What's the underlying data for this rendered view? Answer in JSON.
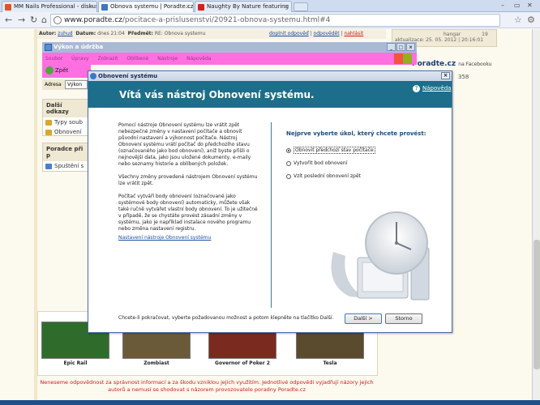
{
  "browser": {
    "tabs": [
      {
        "label": "MM Nails Professional - diskuse",
        "active": false,
        "color": "#e0522a"
      },
      {
        "label": "Obnova systemu | Poradte.cz",
        "active": true,
        "color": "#3a77c9"
      },
      {
        "label": "Naughty By Nature featuring",
        "active": false,
        "color": "#d32020"
      }
    ],
    "url_domain": "www.poradte.cz",
    "url_path": "/pocitace-a-prislusenstvi/20921-obnova-systemu.html#4"
  },
  "forum": {
    "author_label": "Autor:",
    "author": "zuhud",
    "date_label": "Datum:",
    "date": "dnes 21:04",
    "subject_label": "Předmět:",
    "subject": "RE: Obnova systemu",
    "links": [
      "doplnit odpověď",
      "odpovědět",
      "nahlásit"
    ],
    "right_user": "hangar",
    "right_count": "19",
    "right_updated": "aktualizace: 25. 05. 2012 | 20:16:01",
    "fb_brand": "Poradte.cz",
    "fb_suffix": "na Facebooku",
    "fb_count": "358",
    "sidebox1_title": "Další odkazy",
    "sidebox1_items": [
      "Typy soub",
      "Obnovení"
    ],
    "sidebox2_title": "Poradce při p",
    "sidebox2_items": [
      "Spuštění s"
    ],
    "games": [
      {
        "title": "Epic Rail",
        "color": "#2f6c2c"
      },
      {
        "title": "Zombiast",
        "color": "#6b5a3a"
      },
      {
        "title": "Governor of Poker 2",
        "color": "#7a2a1f"
      },
      {
        "title": "Tesla",
        "color": "#5a4a2e"
      }
    ],
    "disclaimer": "Neneseme odpovědnost za správnost informací a za škodu vzniklou jejich využitím. Jednotlivé odpovědi vyjadřují názory jejich autorů a nemusí se shodovat s názorem provozovatele poradny Poradte.cz"
  },
  "xp_window": {
    "title": "Výkon a údržba",
    "menu": [
      "Soubor",
      "Úpravy",
      "Zobrazit",
      "Oblíbené",
      "Nástroje",
      "Nápověda"
    ],
    "back_label": "Zpět",
    "address_label": "Adresa",
    "address_value": "Výkon"
  },
  "dialog": {
    "title": "Obnovení systému",
    "headline": "Vítá vás nástroj Obnovení systému.",
    "help_label": "Nápověda",
    "intro_paragraphs": [
      "Pomocí nástroje Obnovení systému lze vrátit zpět nebezpečné změny v nastavení počítače a obnovit původní nastavení a výkonnost počítače. Nástroj Obnovení systému vrátí počítač do předchozího stavu (označovaného jako bod obnovení), aniž byste přišli o nejnovější data, jako jsou uložené dokumenty, e-maily nebo seznamy historie a oblíbených položek.",
      "Všechny změny provedené nástrojem Obnovení systému lze vrátit zpět.",
      "Počítač vytváří body obnovení (označované jako systémové body obnovení) automaticky, můžete však také ručně vytvářet vlastní body obnovení. To je užitečné v případě, že se chystáte provést zásadní změny v systému, jako je například instalace nového programu nebo změna nastavení registru."
    ],
    "settings_link": "Nastavení nástroje Obnovení systému",
    "choose_label": "Nejprve vyberte úkol, který chcete provést:",
    "options": [
      {
        "label": "Obnovit předchozí stav počítače",
        "selected": true
      },
      {
        "label": "Vytvořit bod obnovení",
        "selected": false
      },
      {
        "label": "Vzít poslední obnovení zpět",
        "selected": false
      }
    ],
    "footer_text": "Chcete-li pokračovat, vyberte požadovanou možnost a potom klepněte na tlačítko Další.",
    "next_label": "Další >",
    "cancel_label": "Storno",
    "header_color": "#1c6e8a"
  }
}
